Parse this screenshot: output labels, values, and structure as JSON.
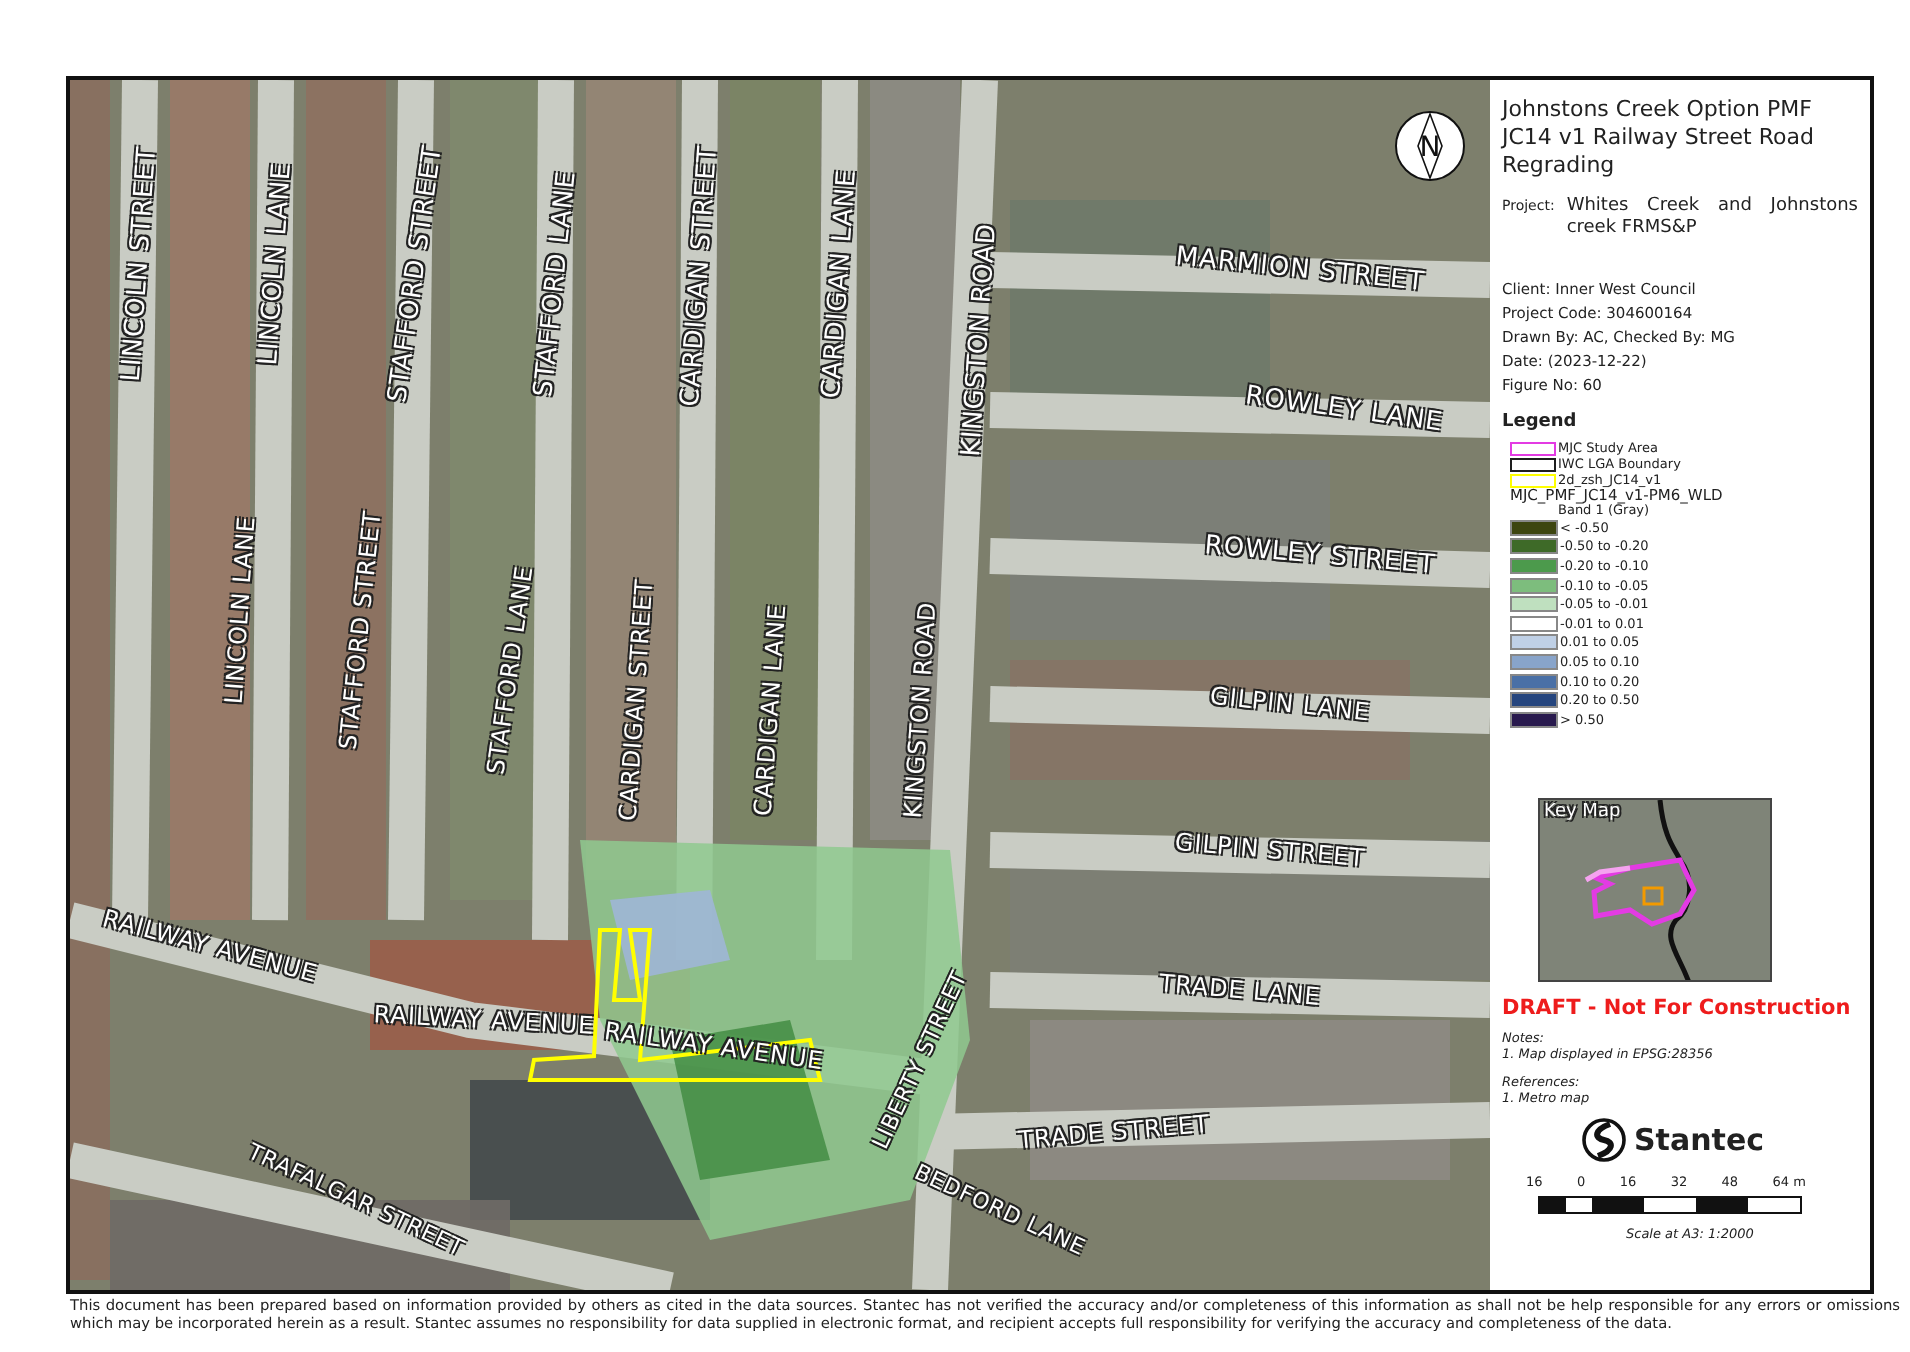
{
  "map": {
    "north_arrow": {
      "label": "N"
    },
    "street_labels": [
      {
        "text": "LINCOLN STREET"
      },
      {
        "text": "LINCOLN LANE"
      },
      {
        "text": "STAFFORD STREET"
      },
      {
        "text": "STAFFORD LANE"
      },
      {
        "text": "CARDIGAN STREET"
      },
      {
        "text": "CARDIGAN LANE"
      },
      {
        "text": "KINGSTON ROAD"
      },
      {
        "text": "MARMION STREET"
      },
      {
        "text": "ROWLEY LANE"
      },
      {
        "text": "ROWLEY STREET"
      },
      {
        "text": "LINCOLN LANE"
      },
      {
        "text": "STAFFORD STREET"
      },
      {
        "text": "STAFFORD LANE"
      },
      {
        "text": "CARDIGAN STREET"
      },
      {
        "text": "CARDIGAN LANE"
      },
      {
        "text": "KINGSTON ROAD"
      },
      {
        "text": "GILPIN LANE"
      },
      {
        "text": "GILPIN STREET"
      },
      {
        "text": "RAILWAY AVENUE"
      },
      {
        "text": "TRADE LANE"
      },
      {
        "text": "RAILWAY AVENUE"
      },
      {
        "text": "RAILWAY AVENUE"
      },
      {
        "text": "LIBERTY STREET"
      },
      {
        "text": "TRADE STREET"
      },
      {
        "text": "TRAFALGAR STREET"
      },
      {
        "text": "BEDFORD LANE"
      }
    ]
  },
  "title_block": {
    "title_lines": [
      "Johnstons Creek Option PMF",
      "JC14 v1 Railway Street Road",
      "Regrading"
    ],
    "project_label": "Project:",
    "project": "Whites Creek and Johnstons creek FRMS&P",
    "fields": [
      {
        "label": "Client:",
        "value": "Inner West Council"
      },
      {
        "label": "Project Code:",
        "value": "304600164"
      },
      {
        "label": "Drawn By:",
        "value": "AC, Checked By: MG"
      },
      {
        "label": "Date:",
        "value": "(2023-12-22)"
      },
      {
        "label": "Figure No:",
        "value": "60"
      }
    ]
  },
  "legend": {
    "title": "Legend",
    "boundaries": [
      {
        "label": "MJC Study Area",
        "color": "#e33be3"
      },
      {
        "label": "IWC LGA Boundary",
        "color": "#1e1e1e"
      },
      {
        "label": "2d_zsh_JC14_v1",
        "color": "#ffff00"
      }
    ],
    "raster_title": "MJC_PMF_JC14_v1-PM6_WLD",
    "band": "Band 1 (Gray)",
    "classes": [
      {
        "label": "< -0.50",
        "color": "#3d4510"
      },
      {
        "label": "-0.50 to -0.20",
        "color": "#3e6a28"
      },
      {
        "label": "-0.20 to -0.10",
        "color": "#4c9a4c"
      },
      {
        "label": "-0.10 to -0.05",
        "color": "#7dbd7d"
      },
      {
        "label": "-0.05 to -0.01",
        "color": "#bfe0bf"
      },
      {
        "label": "-0.01 to 0.01",
        "color": "#ffffff"
      },
      {
        "label": "0.01 to 0.05",
        "color": "#bfd0e6"
      },
      {
        "label": "0.05 to 0.10",
        "color": "#88a4ca"
      },
      {
        "label": "0.10 to 0.20",
        "color": "#4a70a6"
      },
      {
        "label": "0.20 to 0.50",
        "color": "#25457e"
      },
      {
        "label": "> 0.50",
        "color": "#291a4e"
      }
    ]
  },
  "key_map": {
    "label": "Key Map"
  },
  "draft_notice": "DRAFT - Not For Construction",
  "notes": {
    "heading": "Notes:",
    "items": [
      "1. Map displayed in EPSG:28356"
    ]
  },
  "references": {
    "heading": "References:",
    "items": [
      "1. Metro map"
    ]
  },
  "logo": {
    "name": "Stantec"
  },
  "scale_bar": {
    "ticks": [
      "16",
      "0",
      "16",
      "32",
      "48",
      "64 m"
    ],
    "caption": "Scale at A3: 1:2000"
  },
  "disclaimer": "This document has been prepared based on information provided by others as cited in the data sources. Stantec has not verified the accuracy and/or completeness of this information as shall not be help responsible for any errors or omissions which may be incorporated herein as a result. Stantec assumes no responsibility for data supplied in electronic format, and recipient accepts full responsibility for verifying the accuracy and completeness of the data."
}
